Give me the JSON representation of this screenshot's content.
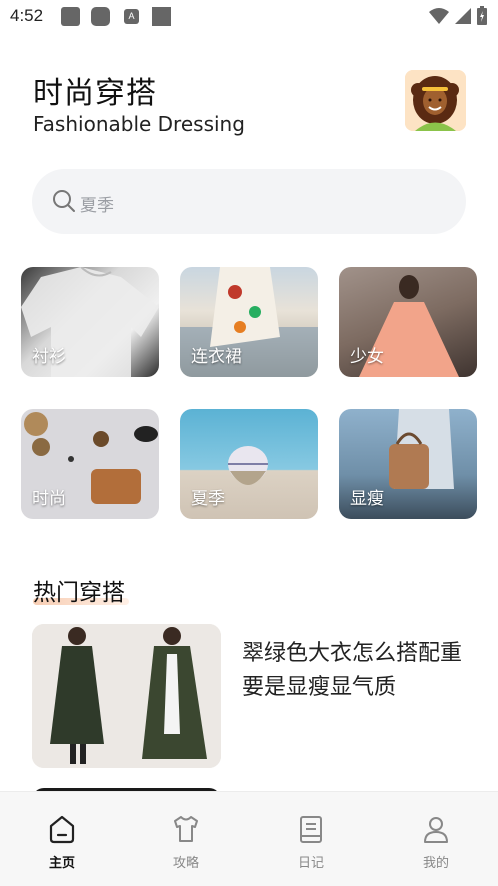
{
  "status_bar": {
    "time": "4:52",
    "notif_a_label": "A"
  },
  "header": {
    "title_cn": "时尚穿搭",
    "title_en": "Fashionable Dressing"
  },
  "search": {
    "placeholder": "夏季"
  },
  "categories": [
    {
      "label": "衬衫"
    },
    {
      "label": "连衣裙"
    },
    {
      "label": "少女"
    },
    {
      "label": "时尚"
    },
    {
      "label": "夏季"
    },
    {
      "label": "显瘦"
    }
  ],
  "hot": {
    "section_title": "热门穿搭",
    "items": [
      {
        "title": "翠绿色大衣怎么搭配重要是显瘦显气质"
      }
    ]
  },
  "tabbar": {
    "tabs": [
      {
        "label": "主页",
        "icon": "home-icon",
        "active": true
      },
      {
        "label": "攻略",
        "icon": "shirt-icon",
        "active": false
      },
      {
        "label": "日记",
        "icon": "notebook-icon",
        "active": false
      },
      {
        "label": "我的",
        "icon": "user-icon",
        "active": false
      }
    ]
  },
  "colors": {
    "accent_underline": "#f7cdb3",
    "search_bg": "#f3f4f6",
    "tabbar_bg": "#f7f7f7"
  }
}
